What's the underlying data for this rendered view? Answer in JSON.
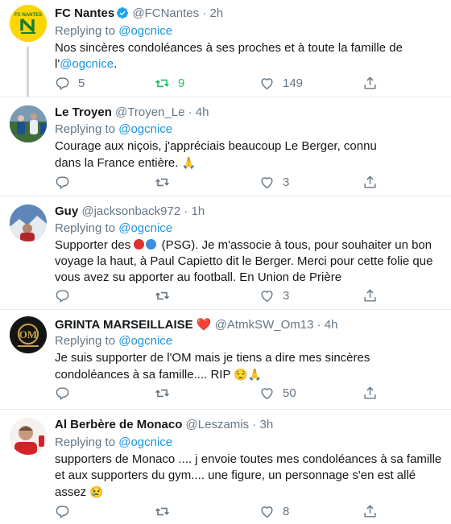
{
  "tweets": [
    {
      "name": "FC Nantes",
      "handle": "@FCNantes",
      "time": "2h",
      "replying_label": "Replying to",
      "replying_to": "@ogcnice",
      "text_a": "Nos sincères condoléances à ses proches et à toute la famille de l'",
      "text_mention": "@ogcnice",
      "text_b": ".",
      "replies": "5",
      "retweets": "9",
      "likes": "149"
    },
    {
      "name": "Le Troyen",
      "handle": "@Troyen_Le",
      "time": "4h",
      "replying_label": "Replying to",
      "replying_to": "@ogcnice",
      "text": "Courage aux niçois, j'appréciais beaucoup Le Berger, connu dans la France entière.",
      "text_emoji": "🙏",
      "replies": "",
      "retweets": "",
      "likes": "3"
    },
    {
      "name": "Guy",
      "handle": "@jacksonback972",
      "time": "1h",
      "replying_label": "Replying to",
      "replying_to": "@ogcnice",
      "text_a": "Supporter des",
      "text_b": "(PSG). Je m'associe à tous, pour souhaiter un bon voyage la haut, à Paul Capietto dit le Berger. Merci pour cette folie que vous avez su apporter au football. En Union de Prière",
      "replies": "",
      "retweets": "",
      "likes": "3"
    },
    {
      "name": "GRINTA MARSEILLAISE",
      "name_emoji": "❤️",
      "handle": "@AtmkSW_Om13",
      "time": "4h",
      "replying_label": "Replying to",
      "replying_to": "@ogcnice",
      "text": "Je suis supporter de l'OM mais je tiens a dire mes sincères condoléances à sa famille.... RIP",
      "text_emoji": "😌🙏",
      "replies": "",
      "retweets": "",
      "likes": "50"
    },
    {
      "name": "Al Berbère de Monaco",
      "handle": "@Leszamis",
      "time": "3h",
      "replying_label": "Replying to",
      "replying_to": "@ogcnice",
      "text": "supporters de Monaco .... j envoie toutes mes condoléances à sa famille et aux supporters du gym.... une figure, un personnage s'en est allé  assez",
      "text_emoji": "😢",
      "replies": "",
      "retweets": "",
      "likes": "8"
    }
  ],
  "separator": "·",
  "colors": {
    "accent": "#1b95e0",
    "retweet_active": "#17bf63",
    "secondary_text": "#657786",
    "nantes_yellow": "#fcd600",
    "nantes_green": "#1b7a3a"
  }
}
